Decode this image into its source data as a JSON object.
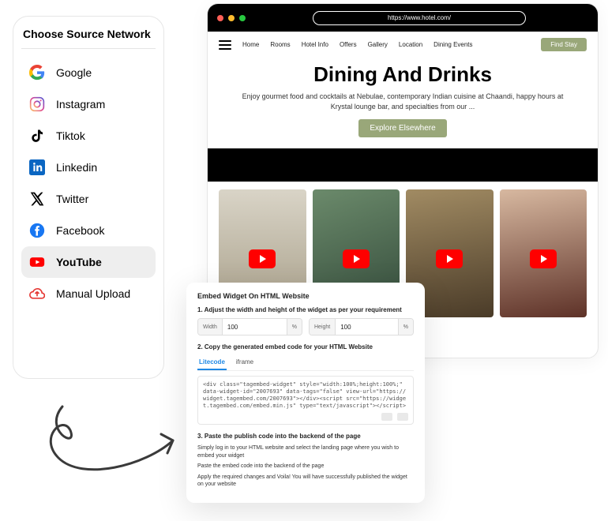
{
  "source_panel": {
    "title": "Choose Source Network",
    "items": [
      {
        "label": "Google",
        "icon": "google-icon"
      },
      {
        "label": "Instagram",
        "icon": "instagram-icon"
      },
      {
        "label": "Tiktok",
        "icon": "tiktok-icon"
      },
      {
        "label": "Linkedin",
        "icon": "linkedin-icon"
      },
      {
        "label": "Twitter",
        "icon": "twitter-icon"
      },
      {
        "label": "Facebook",
        "icon": "facebook-icon"
      },
      {
        "label": "YouTube",
        "icon": "youtube-icon"
      },
      {
        "label": "Manual Upload",
        "icon": "upload-icon"
      }
    ],
    "selected_index": 6
  },
  "browser": {
    "url": "https://www.hotel.com/",
    "nav": [
      "Home",
      "Rooms",
      "Hotel Info",
      "Offers",
      "Gallery",
      "Location",
      "Dining Events"
    ],
    "cta": "Find Stay",
    "hero_title": "Dining And Drinks",
    "hero_sub": "Enjoy gourmet food and cocktails at Nebulae, contemporary Indian cuisine at Chaandi, happy hours at Krystal lounge bar, and specialties from our ...",
    "hero_btn": "Explore Elsewhere"
  },
  "modal": {
    "title": "Embed Widget On HTML Website",
    "step1": "1. Adjust the width and height of the widget as per your requirement",
    "width_label": "Width",
    "width_value": "100",
    "height_label": "Height",
    "height_value": "100",
    "unit": "%",
    "step2": "2. Copy the generated embed code for your HTML Website",
    "tabs": [
      "Litecode",
      "iframe"
    ],
    "active_tab": 0,
    "code": "<div class=\"tagembed-widget\" style=\"width:100%;height:100%;\" data-widget-id=\"2007693\" data-tags=\"false\" view-url=\"https://widget.tagembed.com/2007693\"></div><script src=\"https://widget.tagembed.com/embed.min.js\" type=\"text/javascript\"></script>",
    "step3": "3. Paste the publish code into the backend of the page",
    "line1": "Simply log in to your HTML website and select the landing page where you wish to embed your widget",
    "line2": "Paste the embed code into the backend of the page",
    "line3": "Apply the required changes and Voila! You will have successfully published the widget on your website"
  }
}
